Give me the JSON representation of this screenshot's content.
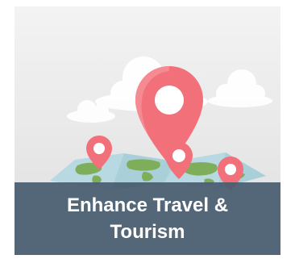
{
  "card": {
    "title_line1": "Enhance Travel &",
    "title_line2": "Tourism"
  },
  "colors": {
    "caption_bg": "#485c6f",
    "pin": "#f2707a",
    "map_land": "#7fae5a",
    "map_water": "#a9cfd9",
    "cloud": "#ffffff"
  },
  "icons": [
    "location-pin-icon",
    "cloud-icon",
    "world-map-icon"
  ]
}
